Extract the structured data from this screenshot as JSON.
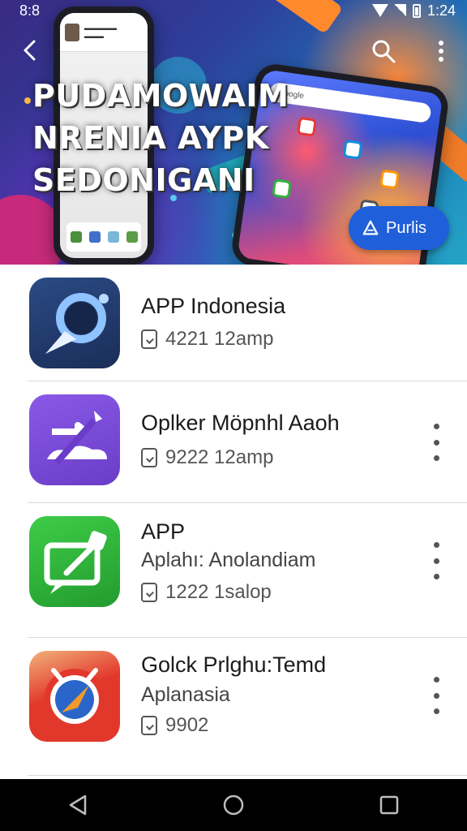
{
  "status_bar": {
    "left_icons": "8:8",
    "time": "1:24"
  },
  "hero": {
    "headline": [
      "PUDAMOWAIM",
      "NRENIA AYPK",
      "SEDONIGANI"
    ],
    "fab_label": "Purlis",
    "search_text": "Google"
  },
  "apps": [
    {
      "title": "APP Indonesia",
      "meta": "4221 12amp",
      "color": "#1d3a70"
    },
    {
      "title": "Oplker Möpnhl Aaoh",
      "meta": "9222 12amp",
      "color": "#7a48d6"
    },
    {
      "title": "APP",
      "subtitle": "Aplahı: Anolandiam",
      "meta": "1222 1salop",
      "color": "#2fb33a"
    },
    {
      "title": "Golck Prlghu:Temd",
      "subtitle": "Aplanasia",
      "meta": "9902",
      "color": "#e2382c"
    }
  ],
  "icons": [
    "back-arrow-icon",
    "search-icon",
    "more-vert-icon",
    "triangle-back-icon",
    "circle-home-icon",
    "square-recents-icon"
  ]
}
